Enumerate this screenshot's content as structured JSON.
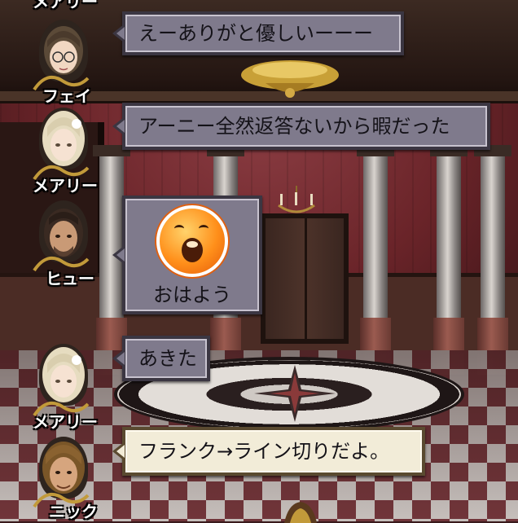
{
  "messages": [
    {
      "speaker": "フェイ",
      "text": "えーありがと優しいーーー"
    },
    {
      "speaker": "メアリー",
      "text": "アーニー全然返答ないから暇だった"
    },
    {
      "speaker": "ヒュー",
      "text": "おはよう",
      "stamp": "yawning-face-stamp"
    },
    {
      "speaker": "メアリー",
      "text": "あきた"
    },
    {
      "speaker": "ニック",
      "text": "フランク→ライン切りだよ。"
    }
  ],
  "top_name_partial": "メアリー",
  "colors": {
    "bubble_dark": "#7f7a8c",
    "bubble_light": "#f2ecd8",
    "name_text": "#ffffff"
  }
}
